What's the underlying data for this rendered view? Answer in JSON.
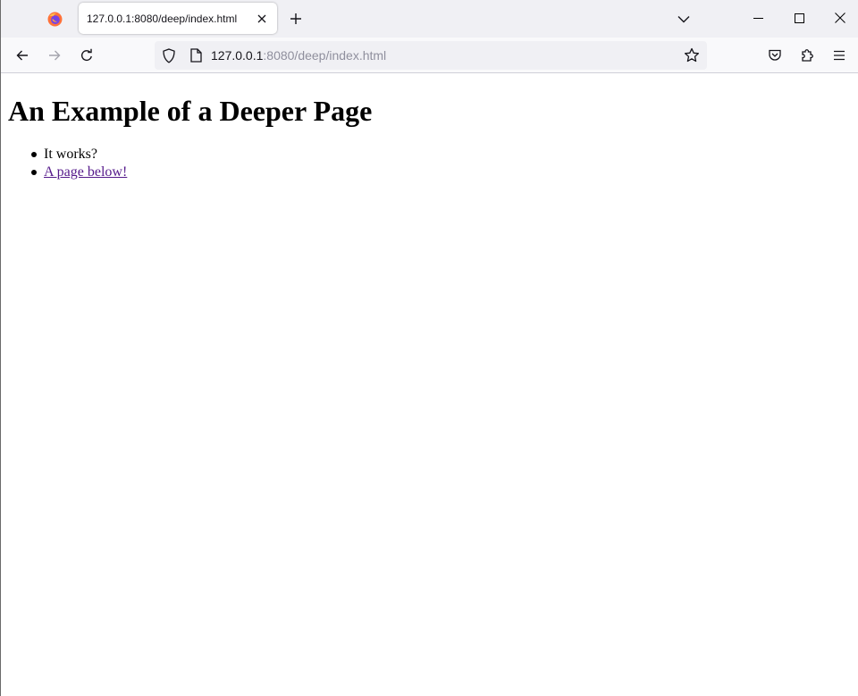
{
  "browser": {
    "tab": {
      "title": "127.0.0.1:8080/deep/index.html"
    },
    "urlbar": {
      "host": "127.0.0.1",
      "rest": ":8080/deep/index.html"
    }
  },
  "page": {
    "heading": "An Example of a Deeper Page",
    "items": [
      {
        "text": "It works?"
      },
      {
        "text": "A page below!"
      }
    ]
  }
}
